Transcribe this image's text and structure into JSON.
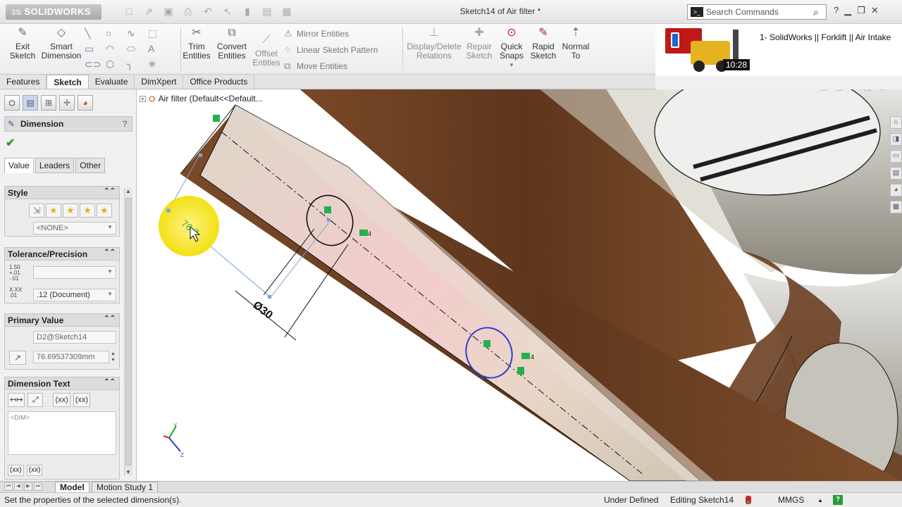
{
  "app": {
    "brand": "SOLIDWORKS",
    "brand_prefix": "3S",
    "document_title": "Sketch14 of Air filter *",
    "search_placeholder": "Search Commands"
  },
  "commands": {
    "exit_sketch": "Exit\nSketch",
    "smart_dimension": "Smart\nDimension",
    "trim_entities": "Trim\nEntities",
    "convert_entities": "Convert\nEntities",
    "offset_entities": "Offset\nEntities",
    "mirror_entities": "Mirror Entities",
    "linear_sketch_pattern": "Linear Sketch Pattern",
    "move_entities": "Move Entities",
    "display_delete_relations": "Display/Delete\nRelations",
    "repair_sketch": "Repair\nSketch",
    "quick_snaps": "Quick\nSnaps",
    "rapid_sketch": "Rapid\nSketch",
    "normal_to": "Normal\nTo"
  },
  "video_overlay": {
    "title": "1- SolidWorks || Forklift || Air Intake",
    "duration": "10:28"
  },
  "tabs": [
    "Features",
    "Sketch",
    "Evaluate",
    "DimXpert",
    "Office Products"
  ],
  "active_tab": "Sketch",
  "property_manager": {
    "title": "Dimension",
    "help": "?",
    "sub_tabs": [
      "Value",
      "Leaders",
      "Other"
    ],
    "style": {
      "heading": "Style",
      "value": "<NONE>"
    },
    "tolerance": {
      "heading": "Tolerance/Precision",
      "tolerance_value": "",
      "precision_value": ".12 (Document)",
      "tol_icon": "1.50 +.01 -.01",
      "prec_icon": "X.XX .01"
    },
    "primary_value": {
      "heading": "Primary Value",
      "name": "D2@Sketch14",
      "value": "76.69537309mm"
    },
    "dimension_text": {
      "heading": "Dimension Text",
      "content": "<DIM>",
      "btn_xx1": "(xx)",
      "btn_xx2": "(xx)",
      "btn_xx3": "(xx)",
      "btn_xx4": "(xx)"
    }
  },
  "graphics": {
    "tree_root": "Air filter  (Default<<Default...",
    "dim_live": "76.7",
    "dim_diameter": "Ø30",
    "relation_label_1": "4",
    "relation_label_2": "4"
  },
  "bottom_tabs": [
    "Model",
    "Motion Study 1"
  ],
  "status": {
    "message": "Set the properties of the selected dimension(s).",
    "definition": "Under Defined",
    "editing": "Editing Sketch14",
    "units": "MMGS",
    "help": "?"
  },
  "colors": {
    "accent_blue": "#2b3fd0",
    "relation_green": "#22b14c",
    "highlight_yellow": "#f5e600",
    "pipe_brown": "#6a3f22"
  },
  "icons": {
    "search": "search-icon",
    "help": "help-icon",
    "ok": "checkmark-icon",
    "collapse": "collapse-icon"
  }
}
